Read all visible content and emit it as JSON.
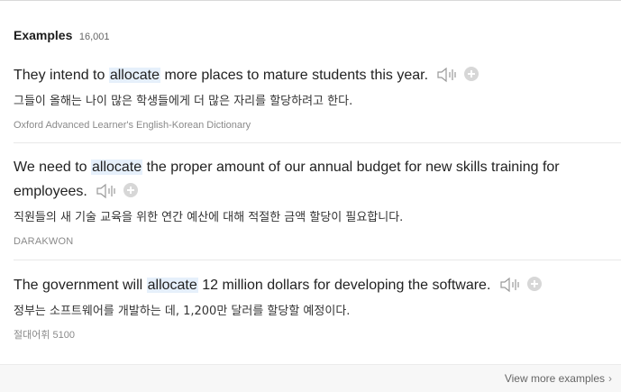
{
  "section": {
    "title": "Examples",
    "count": "16,001"
  },
  "examples": [
    {
      "before": "They intend to ",
      "highlight": "allocate",
      "after": " more places to mature students this year.",
      "translation": "그들이 올해는 나이 많은 학생들에게 더 많은 자리를 할당하려고 한다.",
      "source": "Oxford Advanced Learner's English-Korean Dictionary"
    },
    {
      "before": "We need to ",
      "highlight": "allocate",
      "after": " the proper amount of our annual budget for new skills training for employees.",
      "translation": "직원들의 새 기술 교육을 위한 연간 예산에 대해 적절한 금액 할당이 필요합니다.",
      "source": "DARAKWON"
    },
    {
      "before": "The government will ",
      "highlight": "allocate",
      "after": " 12 million dollars for developing the software.",
      "translation": "정부는 소프트웨어를 개발하는 데, 1,200만 달러를 할당할 예정이다.",
      "source": "절대어휘 5100"
    }
  ],
  "footer": {
    "more_label": "View more examples",
    "chevron": "›"
  },
  "icons": {
    "speaker": "speaker-icon",
    "add": "add-icon"
  },
  "colors": {
    "highlight": "#e6f0fb",
    "icon": "#9a9a9a"
  }
}
